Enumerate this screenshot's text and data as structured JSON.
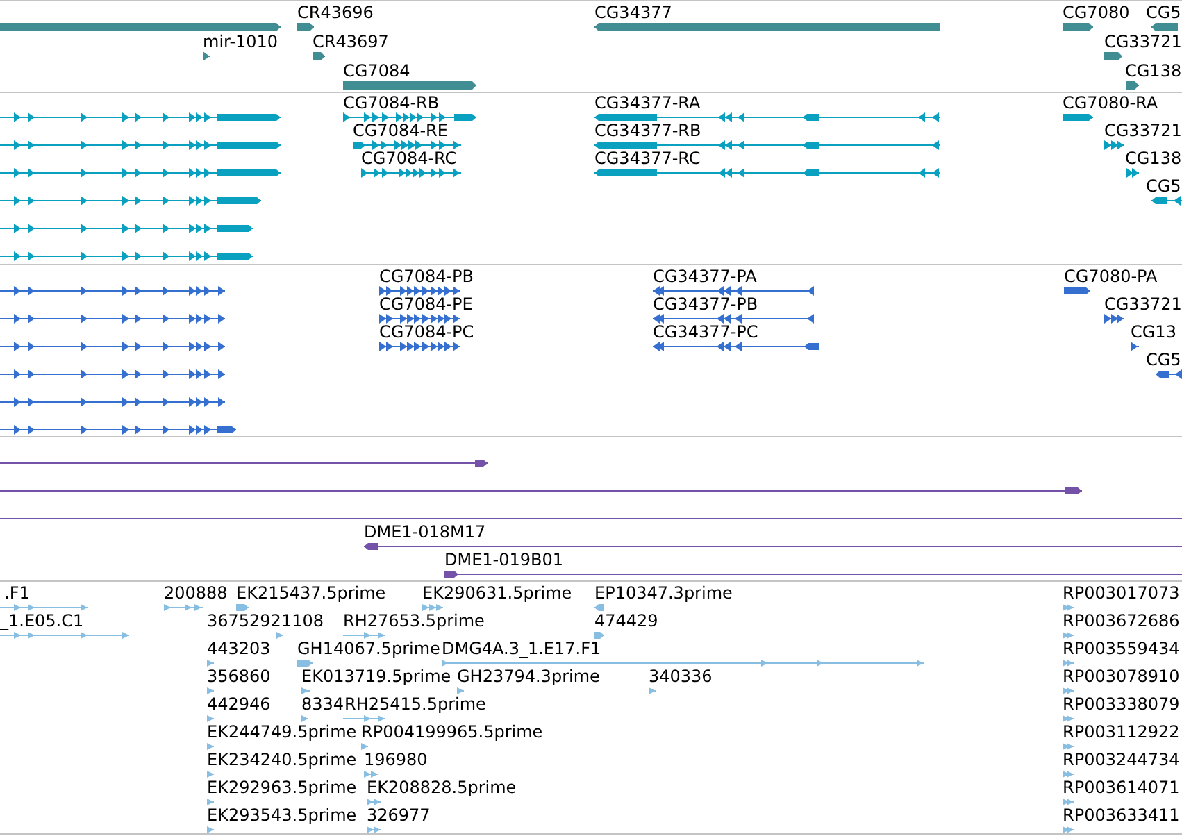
{
  "tracks": [
    {
      "kind": "gene",
      "features": [
        {
          "reverse": false
        },
        {
          "label": "CR43696",
          "reverse": false
        },
        {
          "label": "CG34377",
          "reverse": true
        },
        {
          "label": "CG7080",
          "reverse": false
        },
        {
          "label": "CG5",
          "reverse": true
        },
        {
          "label": "mir-1010",
          "reverse": false
        },
        {
          "label": "CR43697",
          "reverse": false
        },
        {
          "label": "CG33721",
          "reverse": false
        },
        {
          "label": "CG7084",
          "reverse": false
        },
        {
          "label": "CG138",
          "reverse": false
        }
      ]
    },
    {
      "kind": "transcript",
      "features": [
        {
          "reverse": false
        },
        {
          "label": "CG7084-RB",
          "reverse": false
        },
        {
          "label": "CG34377-RA",
          "reverse": true
        },
        {
          "label": "CG7080-RA",
          "reverse": false
        },
        {
          "reverse": false
        },
        {
          "label": "CG7084-RE",
          "reverse": false
        },
        {
          "label": "CG34377-RB",
          "reverse": true
        },
        {
          "label": "CG33721",
          "reverse": false
        },
        {
          "reverse": false
        },
        {
          "label": "CG7084-RC",
          "reverse": false
        },
        {
          "label": "CG34377-RC",
          "reverse": true
        },
        {
          "label": "CG138",
          "reverse": false
        },
        {
          "reverse": false
        },
        {
          "label": "CG5",
          "reverse": true
        },
        {
          "reverse": false
        },
        {
          "reverse": false
        }
      ]
    },
    {
      "kind": "protein",
      "features": [
        {
          "reverse": false
        },
        {
          "label": "CG7084-PB",
          "reverse": false
        },
        {
          "label": "CG34377-PA",
          "reverse": true
        },
        {
          "label": "CG7080-PA",
          "reverse": false
        },
        {
          "reverse": false
        },
        {
          "label": "CG7084-PE",
          "reverse": false
        },
        {
          "label": "CG34377-PB",
          "reverse": true
        },
        {
          "label": "CG33721",
          "reverse": false
        },
        {
          "reverse": false
        },
        {
          "label": "CG7084-PC",
          "reverse": false
        },
        {
          "label": "CG34377-PC",
          "reverse": true
        },
        {
          "label": "CG13",
          "reverse": false
        },
        {
          "reverse": false
        },
        {
          "label": "CG5",
          "reverse": true
        },
        {
          "reverse": false
        },
        {
          "reverse": false
        }
      ]
    },
    {
      "kind": "clone",
      "features": [
        {
          "reverse": false
        },
        {
          "reverse": false
        },
        {
          "clipped": true
        },
        {
          "label": "DME1-018M17",
          "reverse": true
        },
        {
          "label": "DME1-019B01",
          "reverse": false
        }
      ]
    },
    {
      "kind": "est",
      "features": [
        {
          "label": ".F1",
          "reverse": false
        },
        {
          "label": "200888",
          "reverse": false
        },
        {
          "label": "EK215437.5prime",
          "reverse": false
        },
        {
          "label": "EK290631.5prime",
          "reverse": false
        },
        {
          "label": "EP10347.3prime",
          "reverse": true
        },
        {
          "label": "RP003017073",
          "reverse": false
        },
        {
          "label": "_1.E05.C1",
          "reverse": false
        },
        {
          "label": "36752921108",
          "reverse": false
        },
        {
          "label": "RH27653.5prime",
          "reverse": false
        },
        {
          "label": "474429",
          "reverse": false
        },
        {
          "label": "RP003672686",
          "reverse": false
        },
        {
          "label": "443203",
          "reverse": false
        },
        {
          "label": "GH14067.5prime",
          "reverse": false
        },
        {
          "label": "DMG4A.3_1.E17.F1",
          "reverse": false
        },
        {
          "label": "RP003559434",
          "reverse": false
        },
        {
          "label": "356860",
          "reverse": false
        },
        {
          "label": "EK013719.5prime",
          "reverse": false
        },
        {
          "label": "GH23794.3prime",
          "reverse": false
        },
        {
          "label": "340336",
          "reverse": false
        },
        {
          "label": "RP003078910",
          "reverse": false
        },
        {
          "label": "442946",
          "reverse": false
        },
        {
          "label": "8334",
          "reverse": false
        },
        {
          "label": "RH25415.5prime",
          "reverse": false
        },
        {
          "label": "RP003338079",
          "reverse": false
        },
        {
          "label": "EK244749.5prime",
          "reverse": false
        },
        {
          "label": "RP004199965.5prime",
          "reverse": false
        },
        {
          "label": "RP003112922",
          "reverse": false
        },
        {
          "label": "EK234240.5prime",
          "reverse": false
        },
        {
          "label": "196980",
          "reverse": false
        },
        {
          "label": "RP003244734",
          "reverse": false
        },
        {
          "label": "EK292963.5prime",
          "reverse": false
        },
        {
          "label": "EK208828.5prime",
          "reverse": false
        },
        {
          "label": "RP003614071",
          "reverse": false
        },
        {
          "label": "EK293543.5prime",
          "reverse": false
        },
        {
          "label": "326977",
          "reverse": false
        },
        {
          "label": "RP003633411",
          "reverse": false
        }
      ]
    }
  ]
}
